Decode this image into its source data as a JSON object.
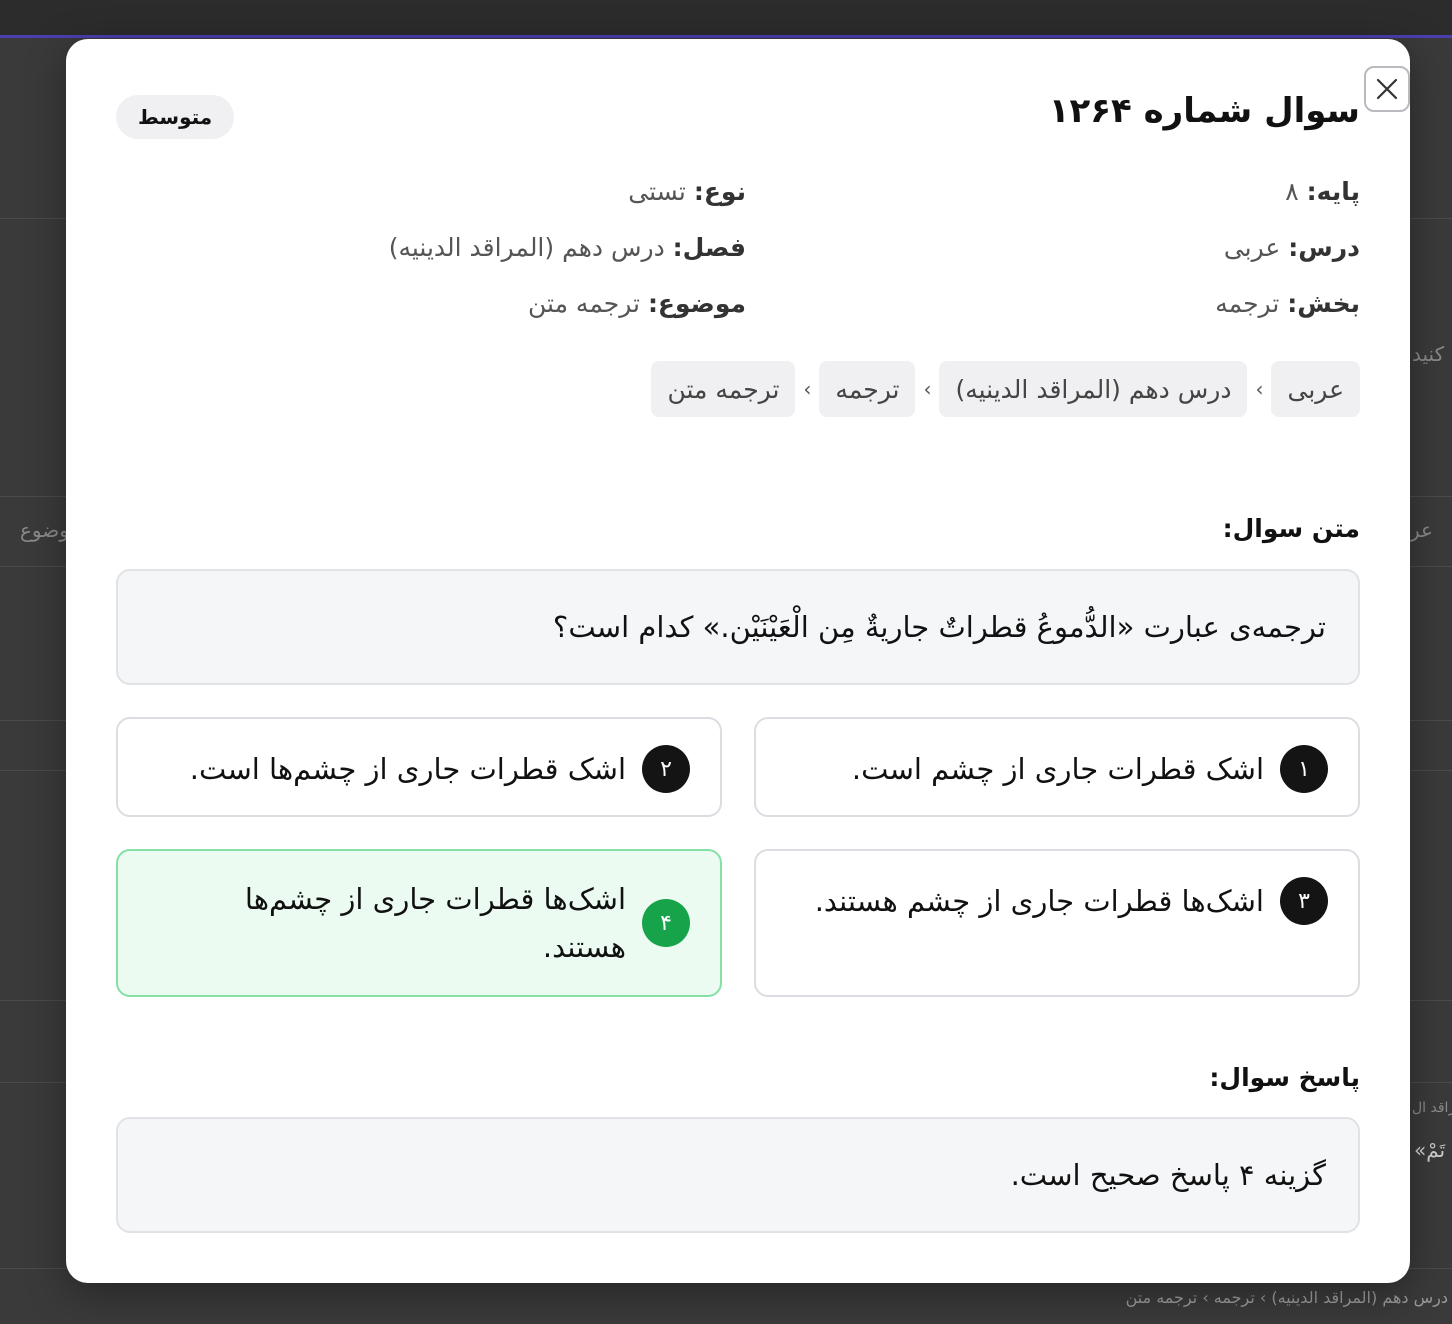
{
  "modal": {
    "title": "سوال شماره ۱۲۶۴",
    "difficulty": "متوسط",
    "meta": [
      {
        "label": "پایه:",
        "value": "۸"
      },
      {
        "label": "نوع:",
        "value": "تستی"
      },
      {
        "label": "درس:",
        "value": "عربی"
      },
      {
        "label": "فصل:",
        "value": "درس دهم (المراقد الدینیه)"
      },
      {
        "label": "بخش:",
        "value": "ترجمه"
      },
      {
        "label": "موضوع:",
        "value": "ترجمه متن"
      }
    ],
    "breadcrumb": [
      "عربی",
      "درس دهم (المراقد الدینیه)",
      "ترجمه",
      "ترجمه متن"
    ],
    "breadcrumb_separator": "›",
    "question_label": "متن سوال:",
    "question_text": "ترجمه‌ی عبارت «الدُّموعُ قطراتٌ جاريةٌ مِن الْعَيْنَيْن.» کدام است؟",
    "options": [
      {
        "num": "۱",
        "text": "اشک قطرات جاری از چشم است.",
        "correct": false
      },
      {
        "num": "۲",
        "text": "اشک قطرات جاری از چشم‌ها است.",
        "correct": false
      },
      {
        "num": "۳",
        "text": "اشک‌ها قطرات جاری از چشم هستند.",
        "correct": false
      },
      {
        "num": "۴",
        "text": "اشک‌ها قطرات جاری از چشم‌ها هستند.",
        "correct": true
      }
    ],
    "answer_label": "پاسخ سوال:",
    "answer_text": "گزینه ۴ پاسخ صحیح است.",
    "close_icon": "close-icon"
  },
  "background": {
    "fragments": [
      "کنید",
      "موضوع",
      "عر",
      "راقد ال",
      "«تَمْ"
    ],
    "breadcrumb": "درس دهم (المراقد الدینیه) › ترجمه › ترجمه متن"
  },
  "colors": {
    "correct_bg": "#ecfbf1",
    "correct_border": "#86e0a6",
    "correct_badge": "#17a34a",
    "badge": "#141414",
    "overlay": "#3a3a3a",
    "accent_line": "#4b3fb0"
  }
}
